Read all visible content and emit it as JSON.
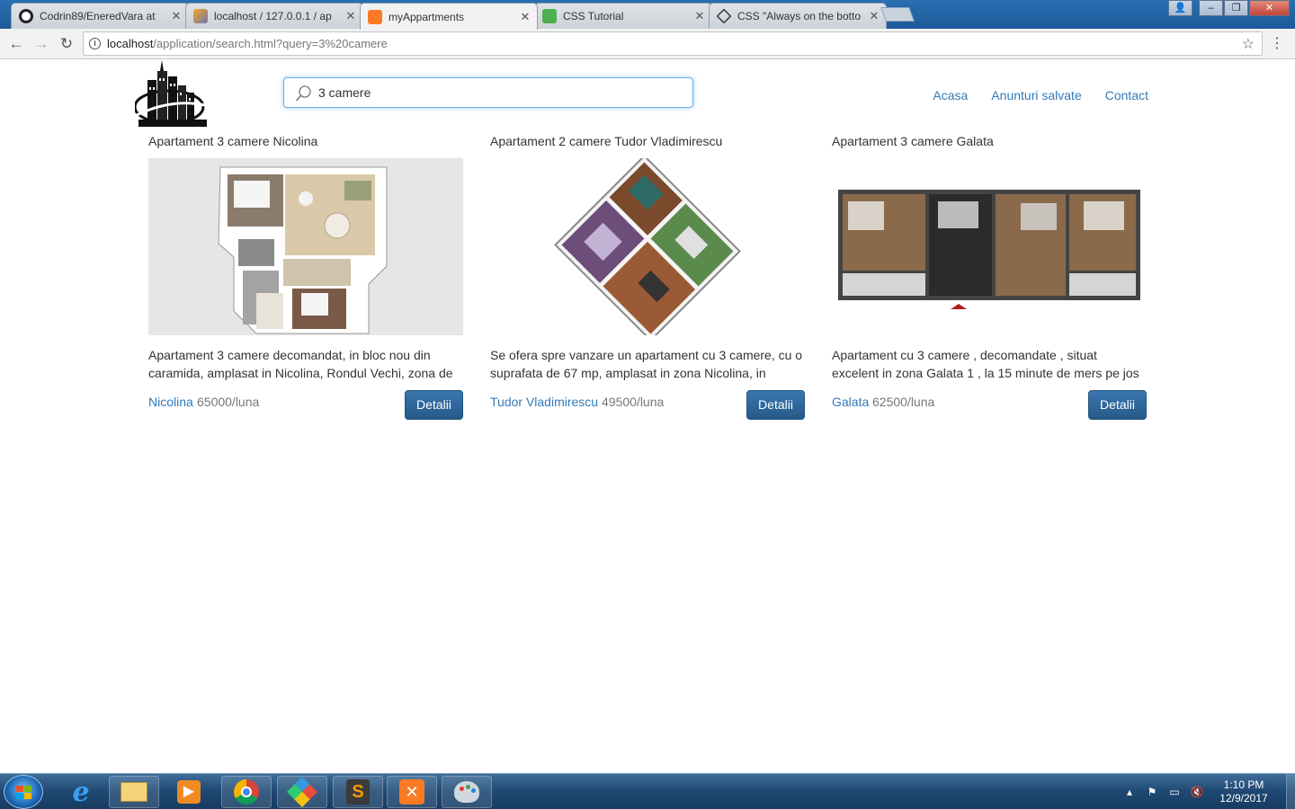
{
  "browser": {
    "tabs": [
      {
        "title": "Codrin89/EneredVara at"
      },
      {
        "title": "localhost / 127.0.0.1 / ap"
      },
      {
        "title": "myAppartments"
      },
      {
        "title": "CSS Tutorial"
      },
      {
        "title": "CSS \"Always on the botto"
      }
    ],
    "url_host": "localhost",
    "url_path": "/application/search.html?query=3%20camere"
  },
  "search": {
    "value": "3 camere"
  },
  "nav": {
    "home": "Acasa",
    "saved": "Anunturi salvate",
    "contact": "Contact"
  },
  "listings": [
    {
      "title": "Apartament 3 camere Nicolina",
      "description": "Apartament 3 camere decomandat, in bloc nou din caramida, amplasat in Nicolina, Rondul Vechi, zona de",
      "location": "Nicolina",
      "price": "65000/luna",
      "button": "Detalii"
    },
    {
      "title": "Apartament 2 camere Tudor Vladimirescu",
      "description": "Se ofera spre vanzare un apartament cu 3 camere, cu o suprafata de 67 mp, amplasat in zona Nicolina, in",
      "location": "Tudor Vladimirescu",
      "price": "49500/luna",
      "button": "Detalii"
    },
    {
      "title": "Apartament 3 camere Galata",
      "description": "Apartament cu 3 camere , decomandate , situat excelent in zona Galata 1 , la 15 minute de mers pe jos",
      "location": "Galata",
      "price": "62500/luna",
      "button": "Detalii"
    }
  ],
  "taskbar": {
    "time": "1:10 PM",
    "date": "12/9/2017"
  },
  "colors": {
    "link": "#337ab7",
    "button": "#2d6ca2",
    "search_focus": "#66afe9"
  }
}
